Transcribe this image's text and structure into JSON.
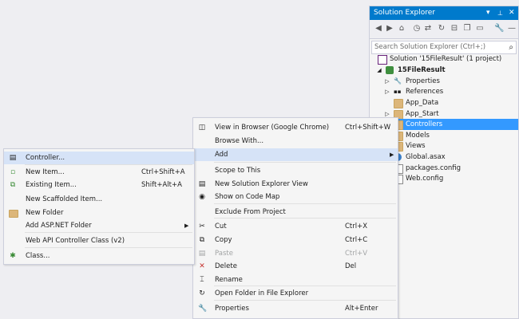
{
  "solution_explorer": {
    "title": "Solution Explorer",
    "title_controls": [
      "▾",
      "📌",
      "✕"
    ],
    "search_placeholder": "Search Solution Explorer (Ctrl+;)",
    "tree": [
      {
        "label": "Solution '15FileResult' (1 project)",
        "icon": "solution-icon"
      },
      {
        "label": "15FileResult",
        "icon": "web-project-icon",
        "bold": true
      },
      {
        "label": "Properties",
        "icon": "wrench-icon"
      },
      {
        "label": "References",
        "icon": "references-icon"
      },
      {
        "label": "App_Data",
        "icon": "folder-icon"
      },
      {
        "label": "App_Start",
        "icon": "folder-icon"
      },
      {
        "label": "Controllers",
        "icon": "folder-icon",
        "selected": true
      },
      {
        "label": "Models",
        "icon": "folder-icon"
      },
      {
        "label": "Views",
        "icon": "folder-icon"
      },
      {
        "label": "Global.asax",
        "icon": "global-asax-icon"
      },
      {
        "label": "packages.config",
        "icon": "config-file-icon"
      },
      {
        "label": "Web.config",
        "icon": "config-file-icon"
      }
    ]
  },
  "context_menu": {
    "items": [
      {
        "label": "View in Browser (Google Chrome)",
        "shortcut": "Ctrl+Shift+W",
        "icon": "browser-icon"
      },
      {
        "label": "Browse With...",
        "shortcut": ""
      },
      {
        "label": "Add",
        "shortcut": "",
        "submenu": true,
        "highlighted": true
      },
      {
        "label": "Scope to This",
        "shortcut": ""
      },
      {
        "label": "New Solution Explorer View",
        "shortcut": "",
        "icon": "new-view-icon"
      },
      {
        "label": "Show on Code Map",
        "shortcut": "",
        "icon": "code-map-icon"
      },
      {
        "label": "Exclude From Project",
        "shortcut": ""
      },
      {
        "label": "Cut",
        "shortcut": "Ctrl+X",
        "icon": "scissors-icon"
      },
      {
        "label": "Copy",
        "shortcut": "Ctrl+C",
        "icon": "copy-icon"
      },
      {
        "label": "Paste",
        "shortcut": "Ctrl+V",
        "icon": "paste-icon",
        "disabled": true
      },
      {
        "label": "Delete",
        "shortcut": "Del",
        "icon": "delete-x-icon"
      },
      {
        "label": "Rename",
        "shortcut": "",
        "icon": "rename-icon"
      },
      {
        "label": "Open Folder in File Explorer",
        "shortcut": "",
        "icon": "refresh-arrow-icon"
      },
      {
        "label": "Properties",
        "shortcut": "Alt+Enter",
        "icon": "wrench-icon"
      }
    ]
  },
  "add_submenu": {
    "items": [
      {
        "label": "Controller...",
        "shortcut": "",
        "icon": "controller-icon",
        "highlighted": true
      },
      {
        "label": "New Item...",
        "shortcut": "Ctrl+Shift+A",
        "icon": "new-item-icon"
      },
      {
        "label": "Existing Item...",
        "shortcut": "Shift+Alt+A",
        "icon": "existing-item-icon"
      },
      {
        "label": "New Scaffolded Item...",
        "shortcut": ""
      },
      {
        "label": "New Folder",
        "shortcut": "",
        "icon": "folder-icon"
      },
      {
        "label": "Add ASP.NET Folder",
        "shortcut": "",
        "submenu": true
      },
      {
        "label": "Web API Controller Class (v2)",
        "shortcut": ""
      },
      {
        "label": "Class...",
        "shortcut": "",
        "icon": "class-icon"
      }
    ]
  },
  "colors": {
    "accent": "#007acc",
    "selection": "#3399ff",
    "menu_highlight": "#d6e3f7"
  }
}
